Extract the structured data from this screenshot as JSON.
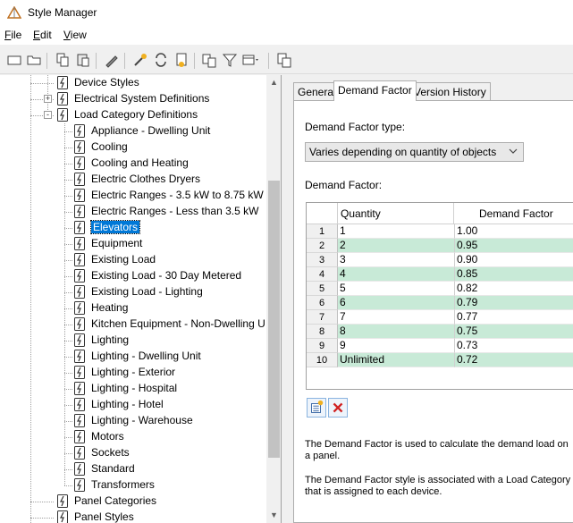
{
  "window": {
    "title": "Style Manager"
  },
  "menu": [
    {
      "label": "File",
      "mnemonic": "F",
      "rest": "ile"
    },
    {
      "label": "Edit",
      "mnemonic": "E",
      "rest": "dit"
    },
    {
      "label": "View",
      "mnemonic": "V",
      "rest": "iew"
    }
  ],
  "toolbar": {
    "buttons": [
      "new-style-icon",
      "open-drawing-icon",
      "copy-icon",
      "paste-icon",
      "edit-style-icon",
      "purge-icon",
      "synchronize-icon",
      "update-standards-icon",
      "toggle-view-icon",
      "filter-icon",
      "view-options-icon",
      "inline-edit-icon"
    ]
  },
  "tree": {
    "items": [
      {
        "label": "Device Styles",
        "level": 1,
        "icon": "device-styles-icon"
      },
      {
        "label": "Electrical System Definitions",
        "level": 1,
        "icon": "electrical-system-icon",
        "expander": "+"
      },
      {
        "label": "Load Category Definitions",
        "level": 1,
        "icon": "load-category-icon",
        "expander": "-"
      },
      {
        "label": "Appliance - Dwelling Unit",
        "level": 2,
        "icon": "load-category-icon"
      },
      {
        "label": "Cooling",
        "level": 2,
        "icon": "load-category-icon"
      },
      {
        "label": "Cooling and Heating",
        "level": 2,
        "icon": "load-category-icon"
      },
      {
        "label": "Electric Clothes Dryers",
        "level": 2,
        "icon": "load-category-icon"
      },
      {
        "label": "Electric Ranges - 3.5 kW to 8.75 kW",
        "level": 2,
        "icon": "load-category-icon"
      },
      {
        "label": "Electric Ranges - Less than 3.5 kW",
        "level": 2,
        "icon": "load-category-icon"
      },
      {
        "label": "Elevators",
        "level": 2,
        "icon": "load-category-icon",
        "selected": true
      },
      {
        "label": "Equipment",
        "level": 2,
        "icon": "load-category-icon"
      },
      {
        "label": "Existing Load",
        "level": 2,
        "icon": "load-category-icon"
      },
      {
        "label": "Existing Load - 30 Day Metered",
        "level": 2,
        "icon": "load-category-icon"
      },
      {
        "label": "Existing Load - Lighting",
        "level": 2,
        "icon": "load-category-icon"
      },
      {
        "label": "Heating",
        "level": 2,
        "icon": "load-category-icon"
      },
      {
        "label": "Kitchen Equipment - Non-Dwelling U",
        "level": 2,
        "icon": "load-category-icon"
      },
      {
        "label": "Lighting",
        "level": 2,
        "icon": "load-category-icon"
      },
      {
        "label": "Lighting - Dwelling Unit",
        "level": 2,
        "icon": "load-category-icon"
      },
      {
        "label": "Lighting - Exterior",
        "level": 2,
        "icon": "load-category-icon"
      },
      {
        "label": "Lighting - Hospital",
        "level": 2,
        "icon": "load-category-icon"
      },
      {
        "label": "Lighting - Hotel",
        "level": 2,
        "icon": "load-category-icon"
      },
      {
        "label": "Lighting - Warehouse",
        "level": 2,
        "icon": "load-category-icon"
      },
      {
        "label": "Motors",
        "level": 2,
        "icon": "load-category-icon"
      },
      {
        "label": "Sockets",
        "level": 2,
        "icon": "load-category-icon"
      },
      {
        "label": "Standard",
        "level": 2,
        "icon": "load-category-icon"
      },
      {
        "label": "Transformers",
        "level": 2,
        "icon": "load-category-icon"
      },
      {
        "label": "Panel Categories",
        "level": 1,
        "icon": "panel-categories-icon"
      },
      {
        "label": "Panel Styles",
        "level": 1,
        "icon": "panel-styles-icon"
      }
    ]
  },
  "tabs": [
    {
      "label": "General",
      "active": false
    },
    {
      "label": "Demand Factor",
      "active": true
    },
    {
      "label": "Version History",
      "active": false
    }
  ],
  "demand": {
    "type_label": "Demand Factor type:",
    "type_value": "Varies depending on quantity of objects",
    "factor_label": "Demand Factor:",
    "columns": {
      "quantity": "Quantity",
      "factor": "Demand Factor"
    },
    "rows": [
      {
        "n": "1",
        "q": "1",
        "f": "1.00"
      },
      {
        "n": "2",
        "q": "2",
        "f": "0.95"
      },
      {
        "n": "3",
        "q": "3",
        "f": "0.90"
      },
      {
        "n": "4",
        "q": "4",
        "f": "0.85"
      },
      {
        "n": "5",
        "q": "5",
        "f": "0.82"
      },
      {
        "n": "6",
        "q": "6",
        "f": "0.79"
      },
      {
        "n": "7",
        "q": "7",
        "f": "0.77"
      },
      {
        "n": "8",
        "q": "8",
        "f": "0.75"
      },
      {
        "n": "9",
        "q": "9",
        "f": "0.73"
      },
      {
        "n": "10",
        "q": "Unlimited",
        "f": "0.72"
      }
    ],
    "desc1": "The Demand Factor is used to calculate the demand load on a panel.",
    "desc2": "The Demand Factor style is associated with a Load Category that is assigned to each device."
  },
  "colors": {
    "selection": "#0078d7",
    "alt_row": "#c8ead7"
  }
}
